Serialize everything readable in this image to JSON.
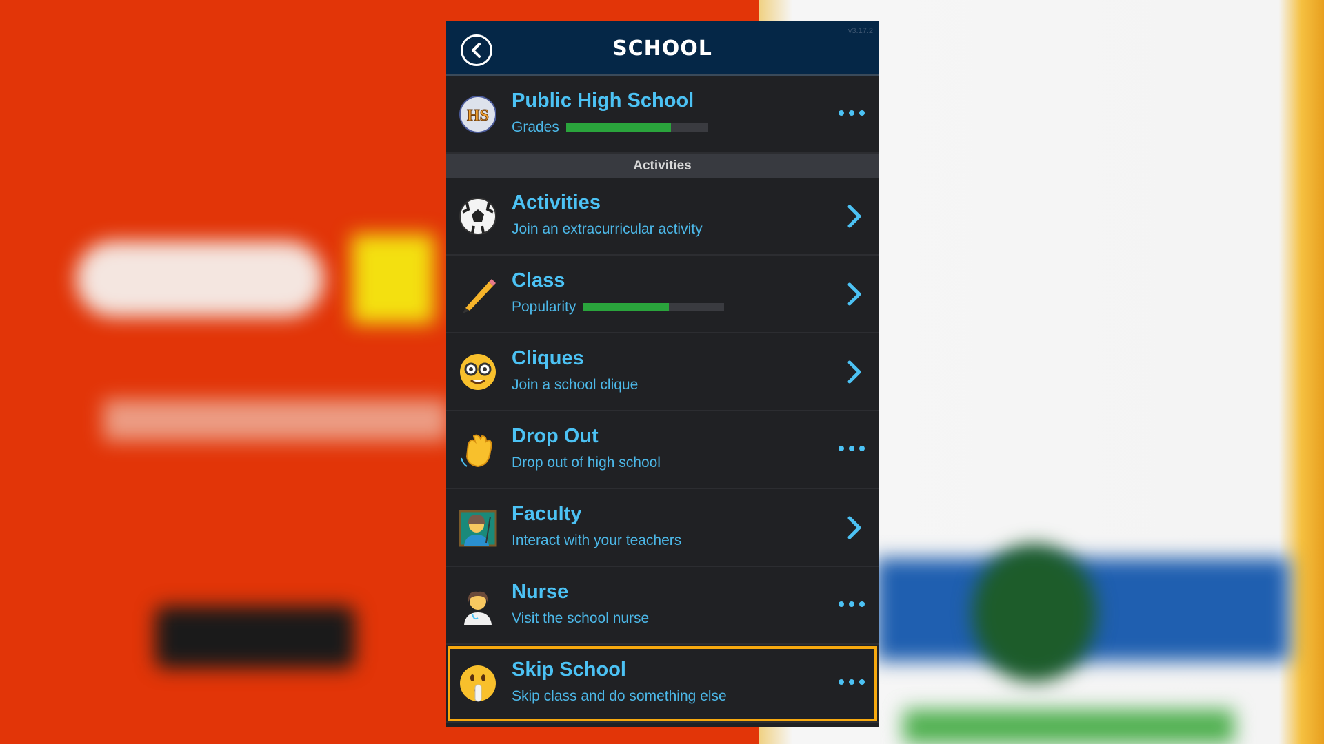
{
  "header": {
    "title": "SCHOOL",
    "version": "v3.17.2"
  },
  "school": {
    "name": "Public High School",
    "stat_label": "Grades",
    "grades_pct": 74,
    "badge": "HS"
  },
  "section_label": "Activities",
  "items": [
    {
      "name": "Activities",
      "sub": "Join an extracurricular activity",
      "icon": "soccer-ball-icon",
      "action": "chevron"
    },
    {
      "name": "Class",
      "sub": "Popularity",
      "popularity_pct": 61,
      "icon": "pencil-icon",
      "action": "chevron"
    },
    {
      "name": "Cliques",
      "sub": "Join a school clique",
      "icon": "nerd-face-icon",
      "action": "chevron"
    },
    {
      "name": "Drop Out",
      "sub": "Drop out of high school",
      "icon": "waving-hand-icon",
      "action": "more"
    },
    {
      "name": "Faculty",
      "sub": "Interact with your teachers",
      "icon": "teacher-icon",
      "action": "chevron"
    },
    {
      "name": "Nurse",
      "sub": "Visit the school nurse",
      "icon": "nurse-icon",
      "action": "more"
    },
    {
      "name": "Skip School",
      "sub": "Skip class and do something else",
      "icon": "shushing-face-icon",
      "action": "more",
      "highlighted": true
    }
  ],
  "colors": {
    "accent": "#4cc2f4",
    "header": "#052747",
    "bar": "#2aa43c",
    "highlight": "#f7a90f"
  }
}
